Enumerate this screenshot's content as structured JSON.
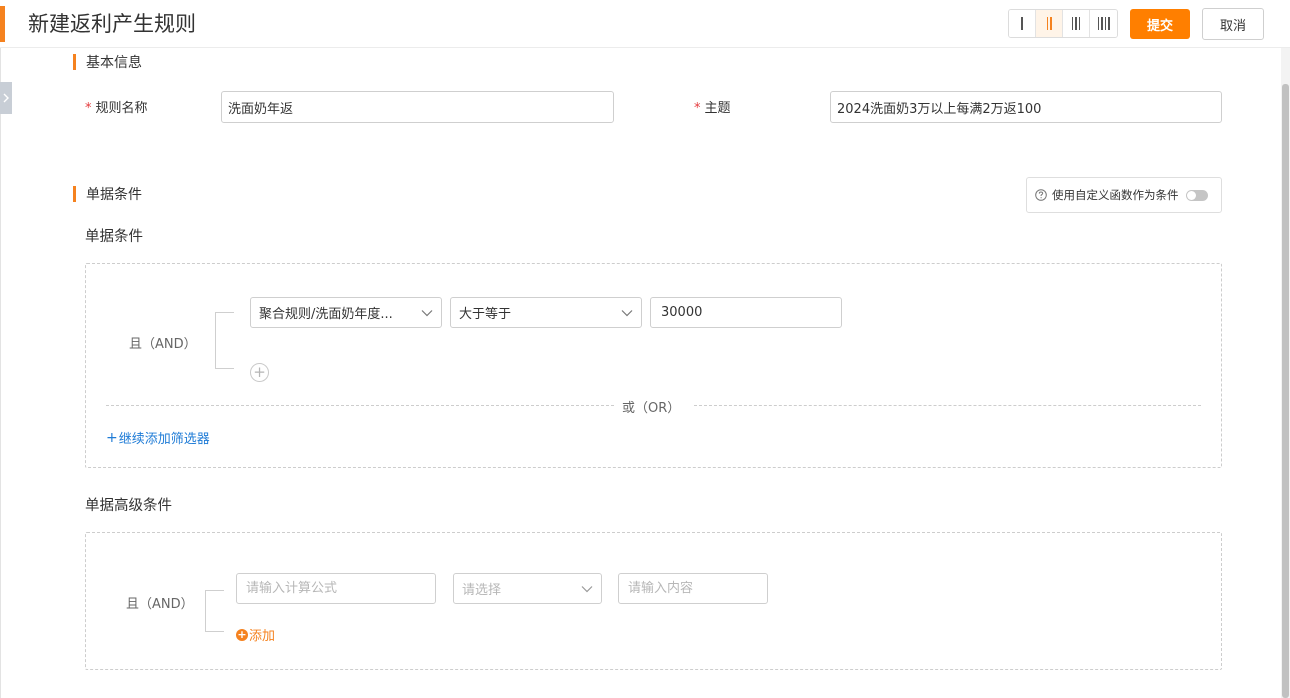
{
  "header": {
    "title": "新建返利产生规则",
    "layout_icons": [
      "one-column-icon",
      "two-column-icon",
      "three-column-icon",
      "four-column-icon"
    ],
    "submit_label": "提交",
    "cancel_label": "取消"
  },
  "basic_info": {
    "section_title": "基本信息",
    "rule_name_label": "规则名称",
    "rule_name_value": "洗面奶年返",
    "topic_label": "主题",
    "topic_value": "2024洗面奶3万以上每满2万返100"
  },
  "doc_conditions": {
    "section_title": "单据条件",
    "custom_function_label": "使用自定义函数作为条件",
    "custom_function_enabled": false,
    "subtitle": "单据条件",
    "and_label": "且（AND）",
    "field_select": "聚合规则/洗面奶年度...",
    "operator_select": "大于等于",
    "value": "30000",
    "or_label": "或（OR）",
    "add_filter_label": "继续添加筛选器"
  },
  "advanced_conditions": {
    "subtitle": "单据高级条件",
    "and_label": "且（AND）",
    "formula_placeholder": "请输入计算公式",
    "select_placeholder": "请选择",
    "content_placeholder": "请输入内容",
    "add_label": "添加"
  },
  "colors": {
    "accent": "#f5821f",
    "submit": "#ff7f00",
    "link": "#1e7bd6",
    "required": "#e4393c"
  }
}
